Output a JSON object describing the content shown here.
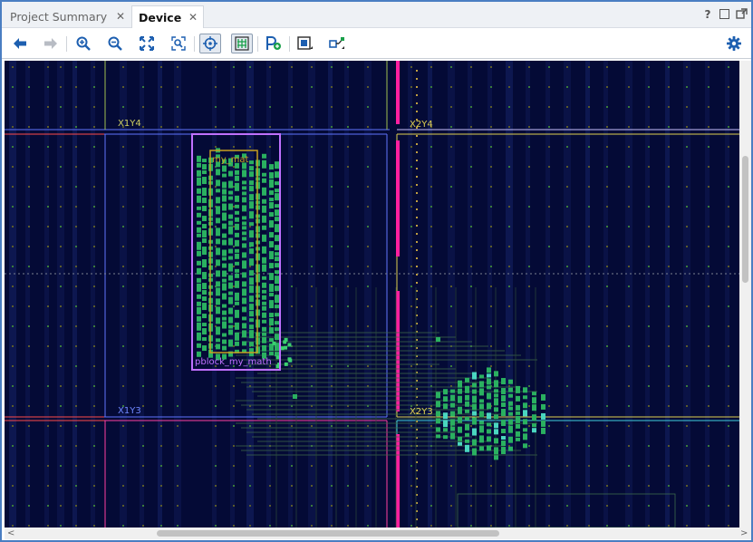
{
  "tabs": [
    {
      "label": "Project Summary",
      "close": "✕",
      "active": false
    },
    {
      "label": "Device",
      "close": "✕",
      "active": true
    }
  ],
  "window_controls": {
    "help": "?",
    "maximize": "□",
    "float": "⧉"
  },
  "toolbar": [
    {
      "name": "back-icon"
    },
    {
      "name": "forward-icon"
    },
    {
      "name": "zoom-in-icon"
    },
    {
      "name": "zoom-out-icon"
    },
    {
      "name": "zoom-fit-icon"
    },
    {
      "name": "zoom-selection-icon"
    },
    {
      "name": "auto-fit-selection-icon"
    },
    {
      "name": "routing-resources-icon"
    },
    {
      "name": "create-pblock-icon"
    },
    {
      "name": "draw-pblock-icon"
    },
    {
      "name": "show-connections-icon"
    },
    {
      "name": "settings-gear-icon"
    }
  ],
  "clock_regions": {
    "x1y4": "X1Y4",
    "x2y4": "X2Y4",
    "x1y3": "X1Y3",
    "x2y3": "X2Y3"
  },
  "pblock": {
    "outer_label": "pblock_my_math",
    "inner_label": "my_mat"
  },
  "colors": {
    "canvas_bg": "#040a36",
    "pblock_outline": "#c070ff",
    "module_outline": "#c8a020",
    "placed_cells": "#2ab060",
    "io_column": "#ff1fa0",
    "region_border": "#5f74ff",
    "accent_border": "#4a7ec2"
  }
}
